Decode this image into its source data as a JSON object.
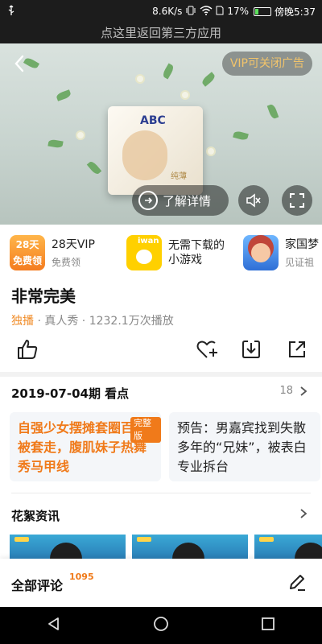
{
  "status_bar": {
    "usb_icon": "usb-icon",
    "speed": "8.6K/s",
    "battery": "17%",
    "time": "傍晚5:37"
  },
  "return_bar": {
    "label": "点这里返回第三方应用"
  },
  "video": {
    "vip_close_label": "VIP可关闭广告",
    "detail_label": "了解详情",
    "product_brand": "ABC",
    "product_tag": "纯薄"
  },
  "recommendations": [
    {
      "title": "28天VIP",
      "sub": "免费领",
      "thumb_top": "28天",
      "thumb_bottom": "免费领"
    },
    {
      "title": "无需下载的小游戏",
      "sub": "",
      "thumb_top": "iwan",
      "thumb_bottom": ""
    },
    {
      "title": "家国梦",
      "sub": "见证祖",
      "thumb_top": "",
      "thumb_bottom": ""
    }
  ],
  "show": {
    "title": "非常完美",
    "exclusive": "独播",
    "meta_rest": "· 真人秀 · 1232.1万次播放"
  },
  "episodes": {
    "heading": "2019-07-04期 看点",
    "count": "18",
    "cards": [
      {
        "text": "自强少女摆摊套圈百已被套走，腹肌妹子热舞秀马甲线",
        "badge": "完整版"
      },
      {
        "text": "预告：男嘉宾找到失散多年的“兄妹”，被表白专业拆台",
        "badge": ""
      }
    ]
  },
  "news": {
    "heading": "花絮资讯"
  },
  "comments": {
    "heading": "全部评论",
    "count": "1095"
  },
  "colors": {
    "accent": "#f07a1a",
    "vip_gold": "#f2c46b",
    "text_main": "#111111",
    "text_muted": "#888888"
  }
}
